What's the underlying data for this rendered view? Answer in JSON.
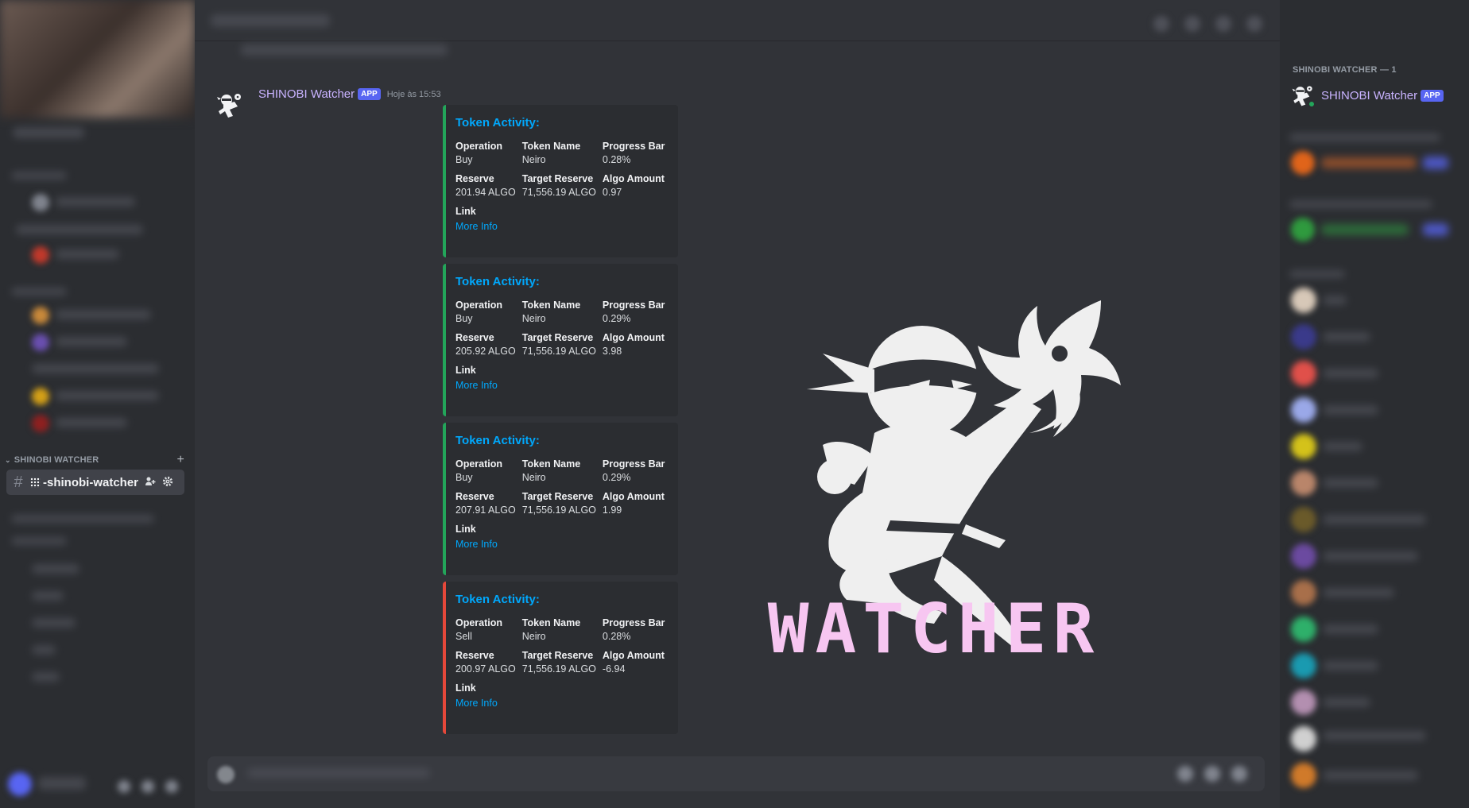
{
  "sidebar": {
    "category": "SHINOBI WATCHER",
    "active_channel": "-shinobi-watcher"
  },
  "message": {
    "author": "SHINOBI Watcher",
    "badge": "APP",
    "timestamp": "Hoje às 15:53"
  },
  "embeds": [
    {
      "title": "Token Activity:",
      "color": "#23a55a",
      "fields": [
        {
          "name": "Operation",
          "value": "Buy"
        },
        {
          "name": "Token Name",
          "value": "Neiro"
        },
        {
          "name": "Progress Bar",
          "value": "0.28%"
        },
        {
          "name": "Reserve",
          "value": "201.94 ALGO"
        },
        {
          "name": "Target Reserve",
          "value": "71,556.19 ALGO"
        },
        {
          "name": "Algo Amount",
          "value": "0.97"
        }
      ],
      "link_label": "Link",
      "link_text": "More Info"
    },
    {
      "title": "Token Activity:",
      "color": "#23a55a",
      "fields": [
        {
          "name": "Operation",
          "value": "Buy"
        },
        {
          "name": "Token Name",
          "value": "Neiro"
        },
        {
          "name": "Progress Bar",
          "value": "0.29%"
        },
        {
          "name": "Reserve",
          "value": "205.92 ALGO"
        },
        {
          "name": "Target Reserve",
          "value": "71,556.19 ALGO"
        },
        {
          "name": "Algo Amount",
          "value": "3.98"
        }
      ],
      "link_label": "Link",
      "link_text": "More Info"
    },
    {
      "title": "Token Activity:",
      "color": "#23a55a",
      "fields": [
        {
          "name": "Operation",
          "value": "Buy"
        },
        {
          "name": "Token Name",
          "value": "Neiro"
        },
        {
          "name": "Progress Bar",
          "value": "0.29%"
        },
        {
          "name": "Reserve",
          "value": "207.91 ALGO"
        },
        {
          "name": "Target Reserve",
          "value": "71,556.19 ALGO"
        },
        {
          "name": "Algo Amount",
          "value": "1.99"
        }
      ],
      "link_label": "Link",
      "link_text": "More Info"
    },
    {
      "title": "Token Activity:",
      "color": "#e5483a",
      "fields": [
        {
          "name": "Operation",
          "value": "Sell"
        },
        {
          "name": "Token Name",
          "value": "Neiro"
        },
        {
          "name": "Progress Bar",
          "value": "0.28%"
        },
        {
          "name": "Reserve",
          "value": "200.97 ALGO"
        },
        {
          "name": "Target Reserve",
          "value": "71,556.19 ALGO"
        },
        {
          "name": "Algo Amount",
          "value": "-6.94"
        }
      ],
      "link_label": "Link",
      "link_text": "More Info"
    }
  ],
  "logo": {
    "text": "WATCHER",
    "text_color": "#f7c6f1"
  },
  "members": {
    "header": "SHINOBI WATCHER — 1",
    "member_name": "SHINOBI Watcher",
    "badge": "APP",
    "status": "online"
  },
  "icons": {
    "channel": "hash-icon",
    "add": "plus-icon",
    "invite": "add-member-icon",
    "settings": "gear-icon"
  }
}
